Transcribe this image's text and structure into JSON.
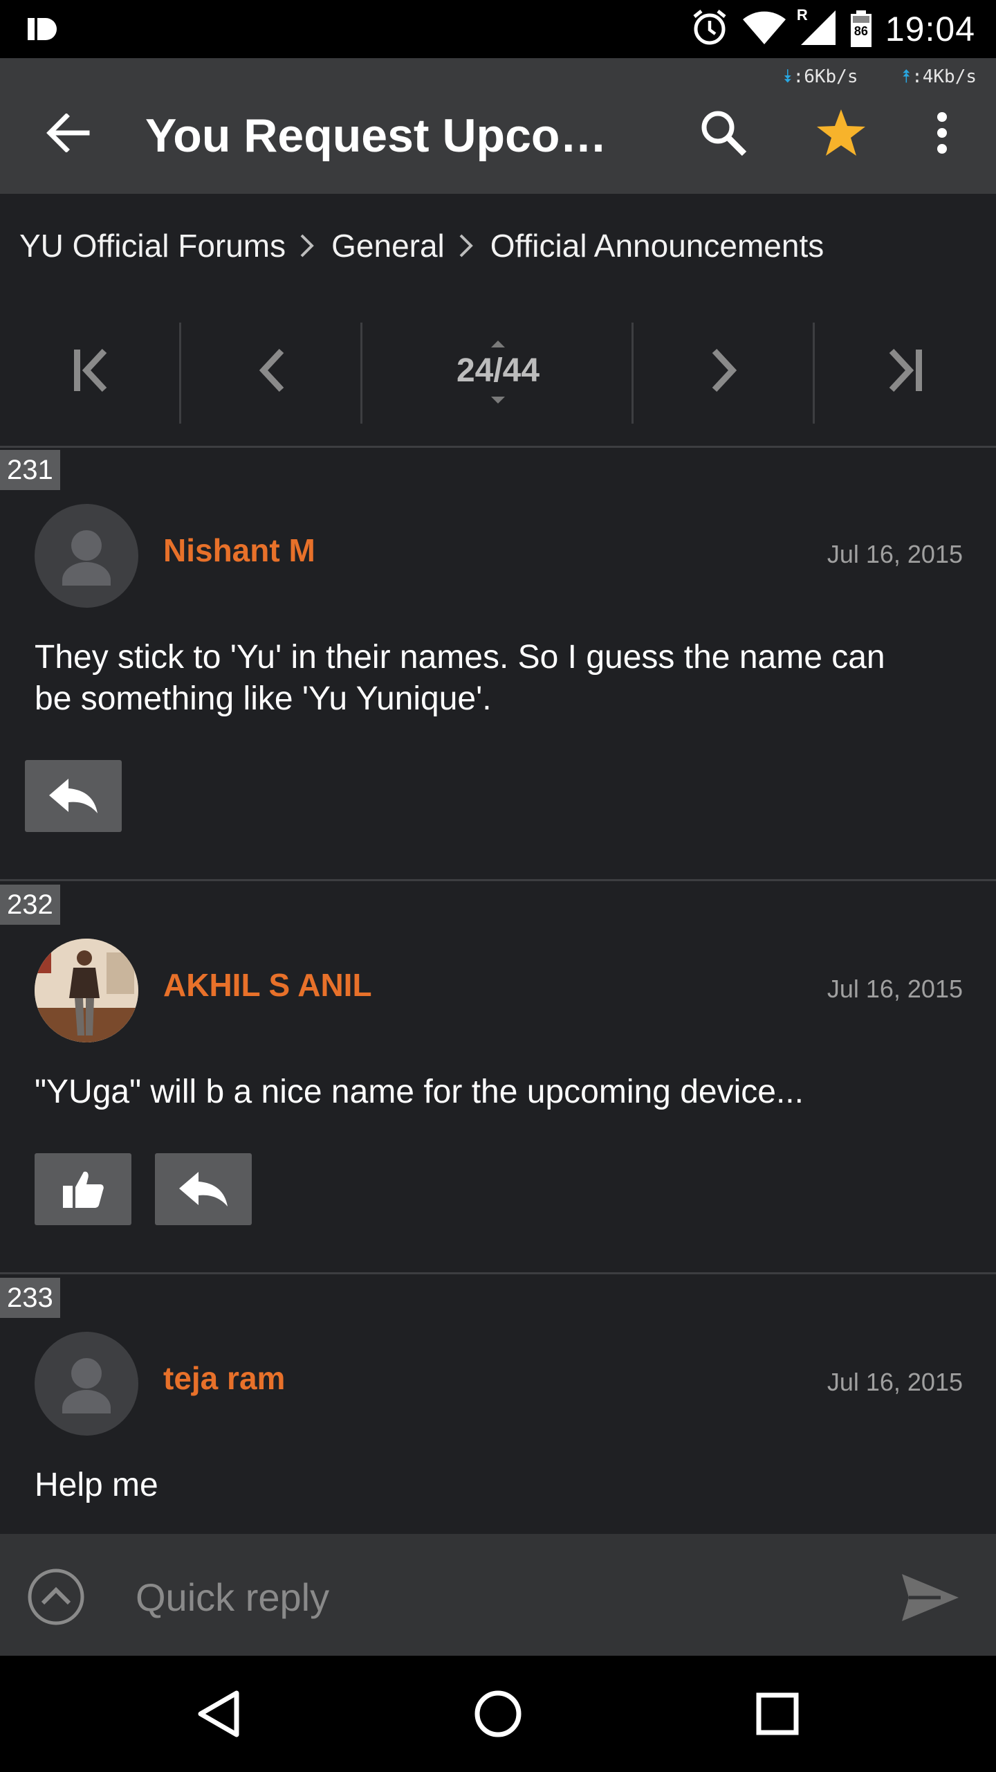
{
  "status_bar": {
    "time": "19:04",
    "battery": "86",
    "signal_roaming": "R",
    "icons": [
      "alarm-icon",
      "wifi-icon",
      "signal-icon",
      "battery-icon"
    ]
  },
  "app_bar": {
    "title": "You Request Upcomi...",
    "net_down": ":6Kb/s",
    "net_up": ":4Kb/s",
    "icons": [
      "back-arrow-icon",
      "search-icon",
      "star-icon",
      "more-vert-icon"
    ],
    "star_color": "#f7b32b"
  },
  "breadcrumb": {
    "items": [
      "YU Official Forums",
      "General",
      "Official Announcements"
    ]
  },
  "pager": {
    "page_label": "24/44",
    "icons": [
      "first-page-icon",
      "previous-page-icon",
      "next-page-icon",
      "last-page-icon"
    ]
  },
  "posts": [
    {
      "number": "231",
      "username": "Nishant M",
      "date": "Jul 16, 2015",
      "body": "They stick to 'Yu' in their names. So I guess the name can be something like 'Yu Yunique'.",
      "avatar": "default-avatar-icon",
      "actions": [
        "reply-icon"
      ]
    },
    {
      "number": "232",
      "username": "AKHIL S ANIL",
      "date": "Jul 16, 2015",
      "body": "\"YUga\" will b a nice name for the upcoming device...",
      "avatar": "user-photo",
      "actions": [
        "like-icon",
        "reply-icon"
      ]
    },
    {
      "number": "233",
      "username": "teja ram",
      "date": "Jul 16, 2015",
      "body": "Help me",
      "avatar": "default-avatar-icon",
      "actions": []
    }
  ],
  "quick_reply": {
    "placeholder": "Quick reply",
    "icons": [
      "expand-up-icon",
      "send-icon"
    ]
  },
  "nav_bar": {
    "icons": [
      "nav-back-icon",
      "nav-home-icon",
      "nav-recents-icon"
    ]
  },
  "colors": {
    "accent_username": "#e8712a",
    "background": "#1f2023",
    "app_bar": "#3a3b3d",
    "button": "#5a5b5d"
  }
}
